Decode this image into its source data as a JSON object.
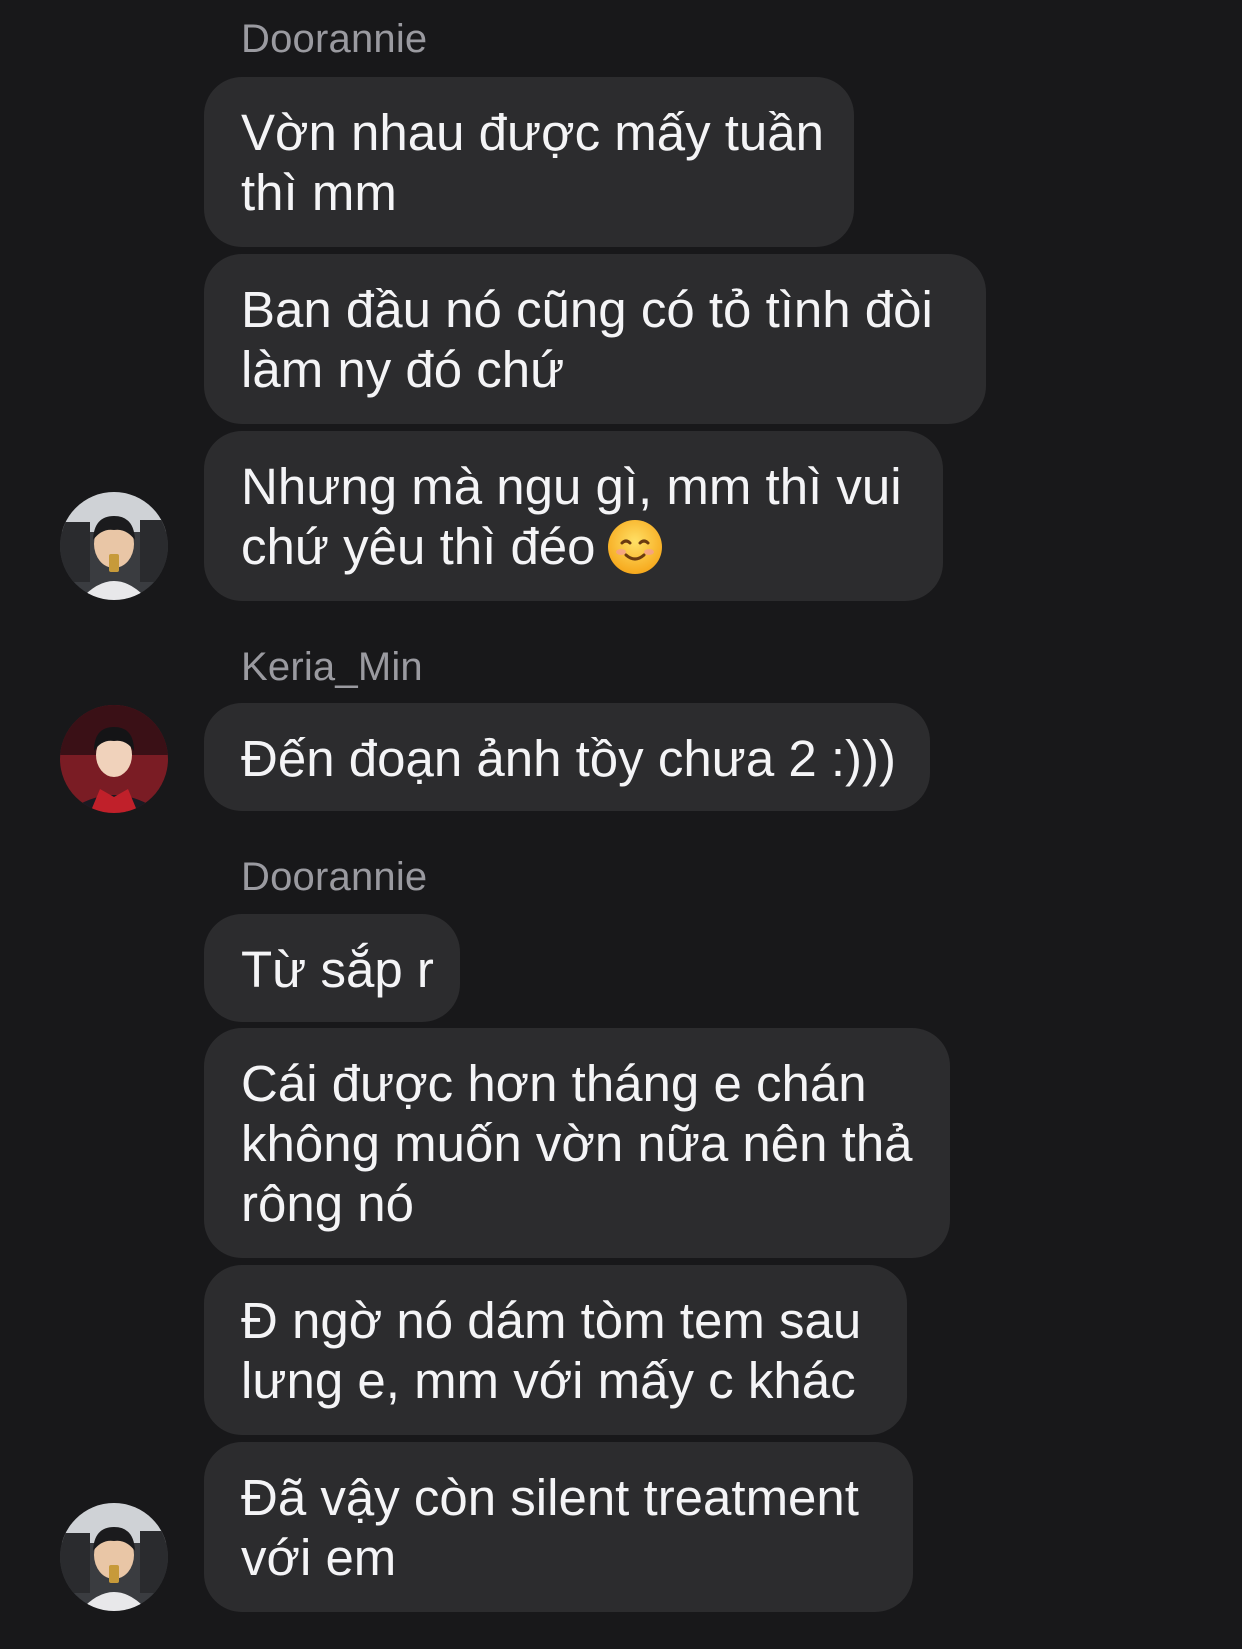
{
  "conversation": {
    "groups": [
      {
        "sender": "Doorannie",
        "messages": [
          {
            "lines": [
              "Vờn nhau được mấy tuần",
              "thì mm"
            ]
          },
          {
            "lines": [
              "Ban đầu nó cũng có tỏ tình đòi",
              "làm ny đó chứ"
            ]
          },
          {
            "lines": [
              "Nhưng mà ngu gì, mm thì vui",
              "chứ yêu thì đéo"
            ],
            "emoji": "smiling-face-emoji"
          }
        ]
      },
      {
        "sender": "Keria_Min",
        "messages": [
          {
            "lines": [
              "Đến đoạn ảnh tồy chưa 2 :)))"
            ]
          }
        ]
      },
      {
        "sender": "Doorannie",
        "messages": [
          {
            "lines": [
              "Từ sắp r"
            ]
          },
          {
            "lines": [
              "Cái được hơn tháng e chán",
              "không muốn vờn nữa nên thả",
              "rông nó"
            ]
          },
          {
            "lines": [
              "Đ ngờ nó dám tòm tem sau",
              "lưng e, mm với mấy c khác"
            ]
          },
          {
            "lines": [
              "Đã vậy còn silent treatment",
              "với em"
            ]
          }
        ]
      }
    ]
  },
  "colors": {
    "background": "#18181a",
    "bubble": "#2c2c2e",
    "sender_name": "#9a9aa0",
    "message_text": "#f4f4f6"
  }
}
